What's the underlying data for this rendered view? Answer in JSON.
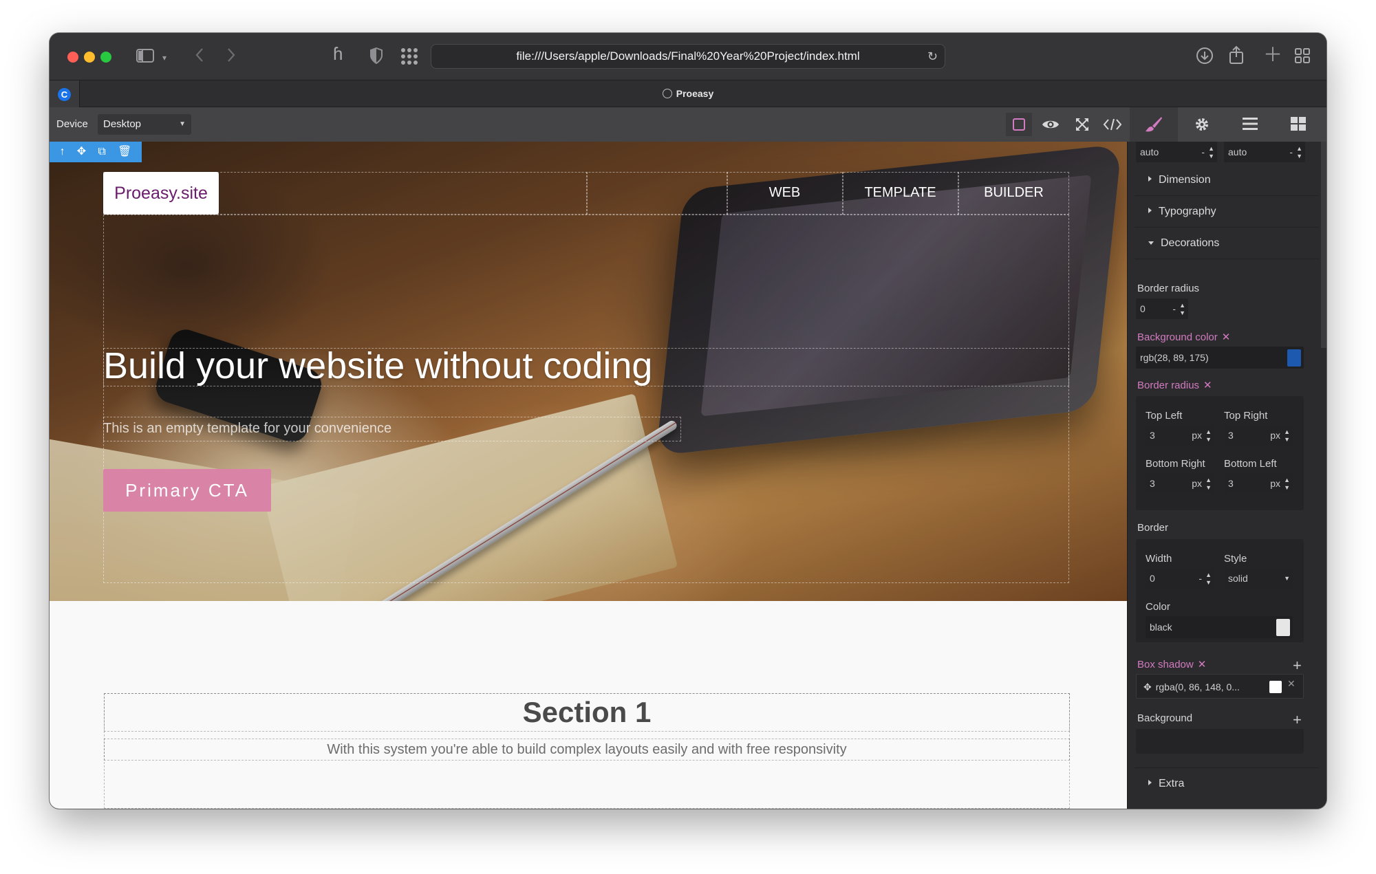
{
  "browser": {
    "url": "file:///Users/apple/Downloads/Final%20Year%20Project/index.html",
    "tab_title": "Proeasy"
  },
  "editor": {
    "device_label": "Device",
    "device_value": "Desktop"
  },
  "canvas": {
    "logo": "Proeasy.site",
    "nav": [
      "WEB",
      "TEMPLATE",
      "BUILDER"
    ],
    "hero_title": "Build your website without coding",
    "hero_subtitle": "This is an empty template for your convenience",
    "cta_label": "Primary CTA",
    "section_title": "Section 1",
    "section_desc": "With this system you're able to build complex layouts easily and with free responsivity"
  },
  "panel": {
    "top_fields": [
      {
        "value": "auto",
        "unit": "-"
      },
      {
        "value": "auto",
        "unit": "-"
      }
    ],
    "sectors": {
      "dimension": "Dimension",
      "typography": "Typography",
      "decorations": "Decorations",
      "extra": "Extra"
    },
    "border_radius_label": "Border radius",
    "border_radius_value": {
      "value": "0",
      "unit": "-"
    },
    "background_color_label": "Background color",
    "background_color_value": "rgb(28, 89, 175)",
    "background_color_swatch": "#1c59af",
    "border_radius2_label": "Border radius",
    "corners": [
      {
        "label": "Top Left",
        "value": "3",
        "unit": "px"
      },
      {
        "label": "Top Right",
        "value": "3",
        "unit": "px"
      },
      {
        "label": "Bottom Right",
        "value": "3",
        "unit": "px"
      },
      {
        "label": "Bottom Left",
        "value": "3",
        "unit": "px"
      }
    ],
    "border_label": "Border",
    "border_width_label": "Width",
    "border_width_value": {
      "value": "0",
      "unit": "-"
    },
    "border_style_label": "Style",
    "border_style_value": "solid",
    "border_color_label": "Color",
    "border_color_value": "black",
    "box_shadow_label": "Box shadow",
    "box_shadow_value": "rgba(0, 86, 148, 0...",
    "background_label": "Background",
    "clear_mark": "✕"
  },
  "colors": {
    "accent_pink": "#d27bc0",
    "cta": "#d983a6",
    "selection_blue": "#3b97e3",
    "logo_text": "#6a1b6b"
  }
}
